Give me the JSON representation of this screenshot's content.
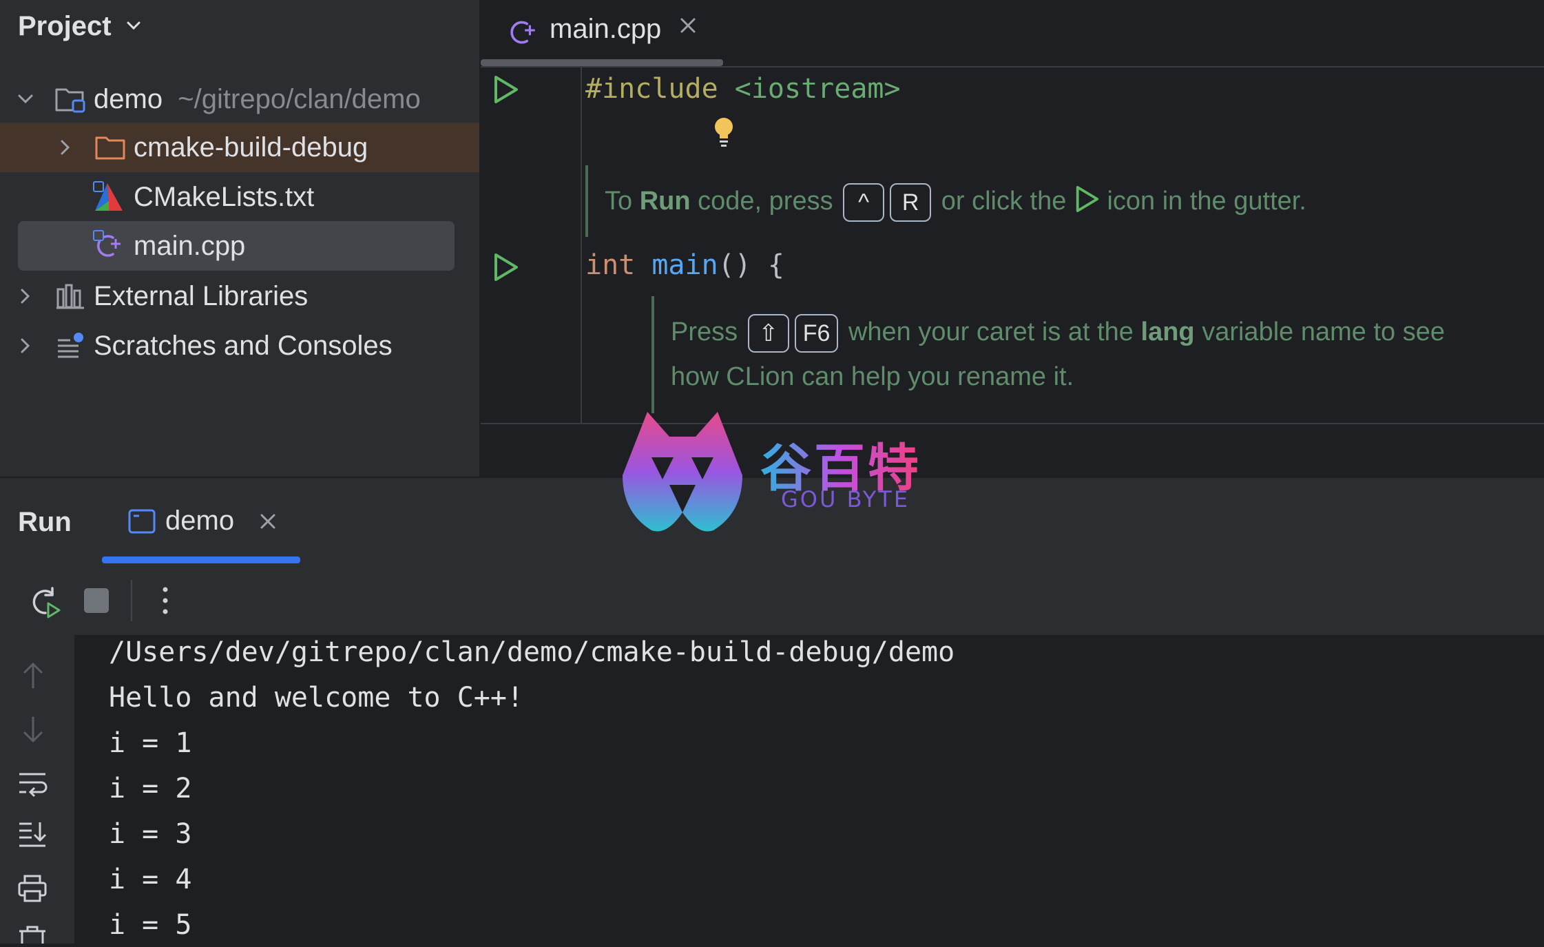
{
  "project": {
    "title": "Project",
    "tree": {
      "demo": {
        "name": "demo",
        "path": "~/gitrepo/clan/demo"
      },
      "cmake_build": "cmake-build-debug",
      "cmakelists": "CMakeLists.txt",
      "main": "main.cpp",
      "external": "External Libraries",
      "scratches": "Scratches and Consoles"
    }
  },
  "editor": {
    "tab": "main.cpp",
    "code": {
      "include_kw": "#include",
      "include_file": "<iostream>",
      "int_kw": "int",
      "main_fn": "main",
      "main_rest": "() {"
    },
    "doc1": {
      "pre": "To",
      "bold": "Run",
      "mid": "code, press",
      "key1": "^",
      "key2": "R",
      "post1": "or click the",
      "post2": "icon in the gutter."
    },
    "doc2": {
      "pre": "Press",
      "key1": "⇧",
      "key2": "F6",
      "mid": "when your caret is at the",
      "bold": "lang",
      "post": "variable name to see",
      "line2": "how CLion can help you rename it."
    }
  },
  "run": {
    "title": "Run",
    "tab": "demo",
    "output": [
      "/Users/dev/gitrepo/clan/demo/cmake-build-debug/demo",
      "Hello and welcome to C++!",
      "i = 1",
      "i = 2",
      "i = 3",
      "i = 4",
      "i = 5"
    ]
  },
  "watermark": {
    "cn": "谷百特",
    "en": "GOU BYTE"
  },
  "colors": {
    "accent": "#3574f0",
    "run_green": "#5fb865",
    "selection": "#43454a"
  }
}
